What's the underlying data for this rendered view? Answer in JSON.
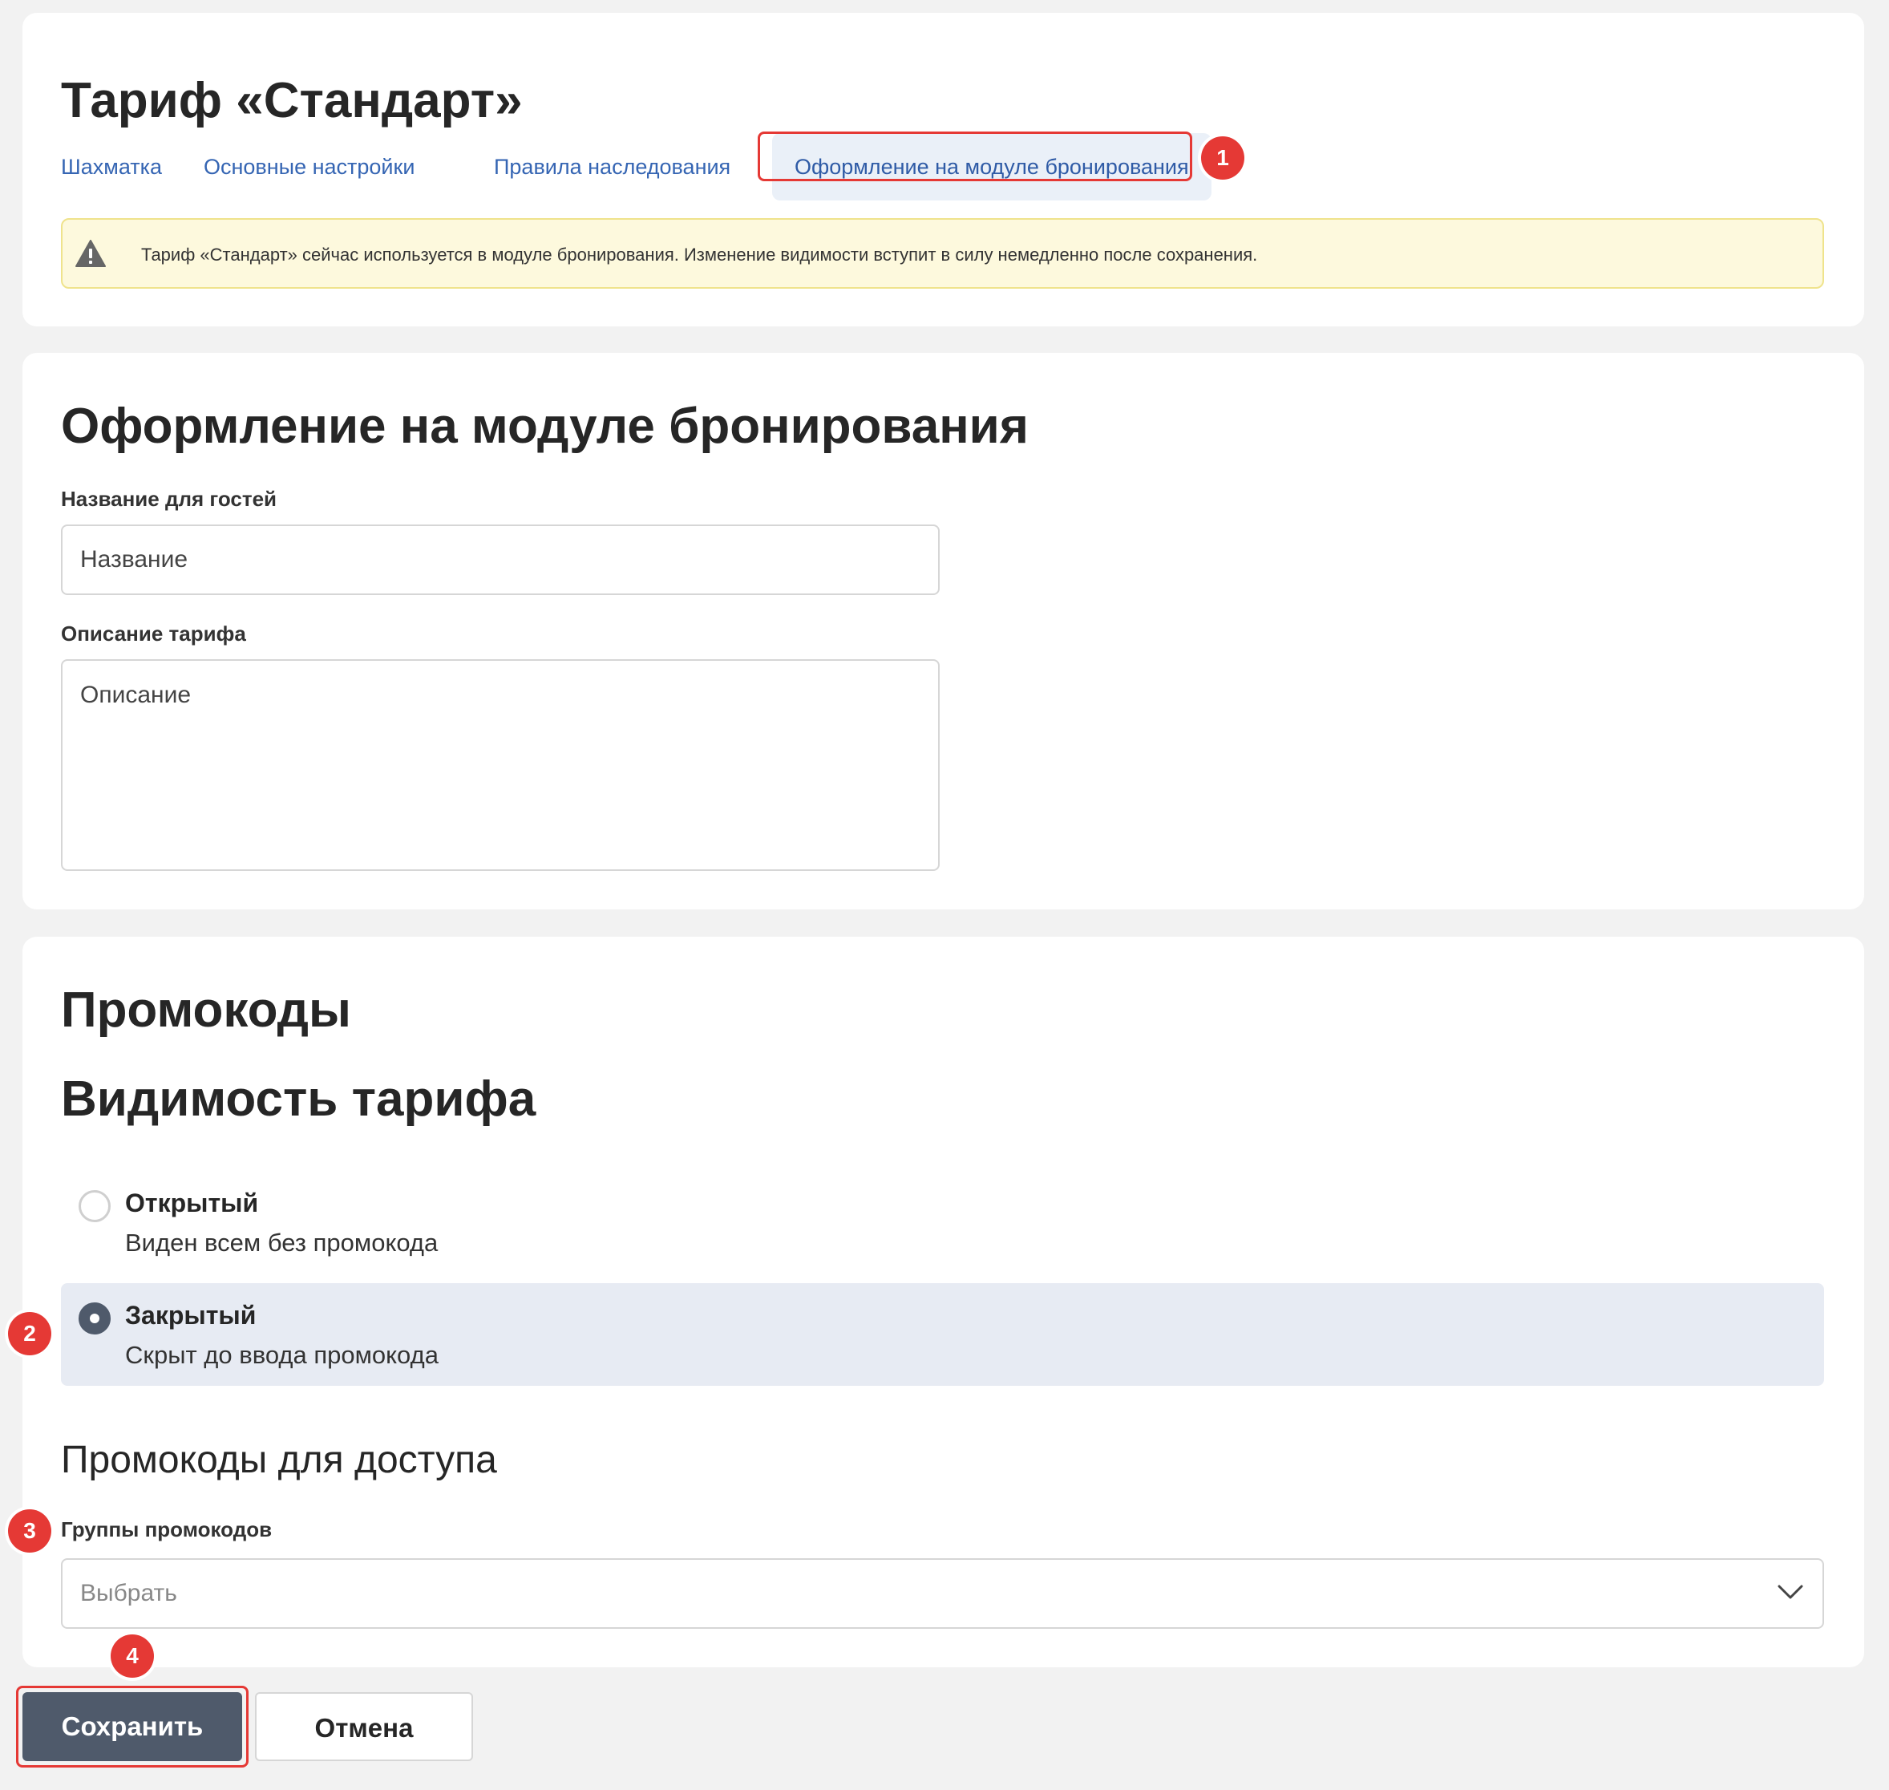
{
  "header": {
    "title": "Тариф «Стандарт»",
    "tabs": [
      {
        "label": "Шахматка",
        "active": false
      },
      {
        "label": "Основные настройки",
        "active": false
      },
      {
        "label": "Правила наследования",
        "active": false
      },
      {
        "label": "Оформление на модуле бронирования",
        "active": true
      }
    ],
    "warning": {
      "icon": "warning-triangle-icon",
      "text": "Тариф «Стандарт» сейчас используется в модуле бронирования. Изменение видимости вступит в силу немедленно после сохранения."
    }
  },
  "design": {
    "title": "Оформление на модуле бронирования",
    "guest_name": {
      "label": "Название для гостей",
      "placeholder": "Название",
      "value": ""
    },
    "description": {
      "label": "Описание тарифа",
      "placeholder": "Описание",
      "value": ""
    }
  },
  "promo": {
    "title": "Промокоды",
    "visibility": {
      "title": "Видимость тарифа",
      "options": [
        {
          "title": "Открытый",
          "description": "Виден всем без промокода",
          "selected": false
        },
        {
          "title": "Закрытый",
          "description": "Скрыт до ввода промокода",
          "selected": true
        }
      ]
    },
    "access": {
      "title": "Промокоды для доступа",
      "groups_label": "Группы промокодов",
      "groups_placeholder": "Выбрать"
    }
  },
  "actions": {
    "save_label": "Сохранить",
    "cancel_label": "Отмена"
  },
  "callouts": [
    "1",
    "2",
    "3",
    "4"
  ],
  "colors": {
    "accent_dark": "#4f5a6b",
    "link_blue": "#3565b3",
    "callout_red": "#e53935",
    "warning_bg": "#fdf9dd"
  }
}
